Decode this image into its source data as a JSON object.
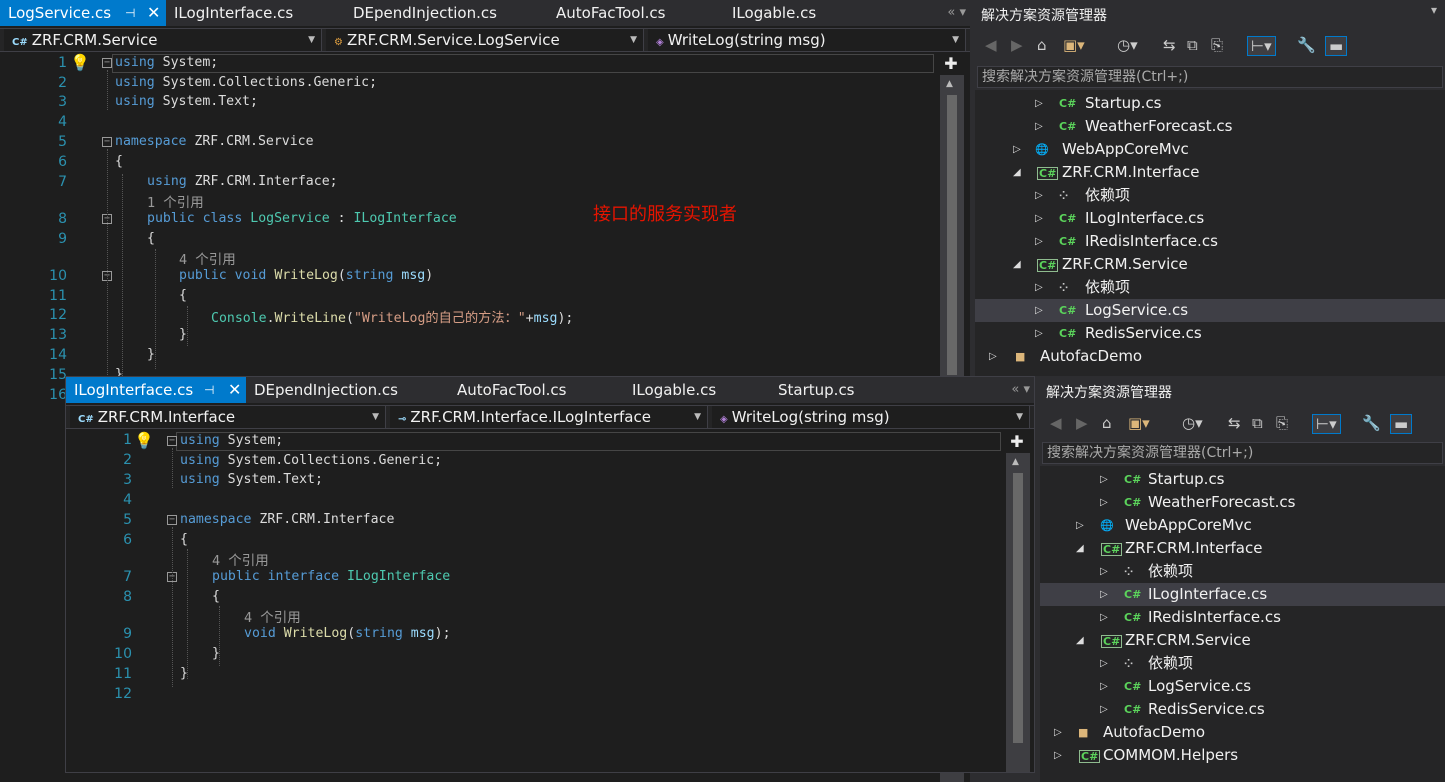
{
  "window1": {
    "tabs": [
      {
        "label": "LogService.cs",
        "active": true
      },
      {
        "label": "ILogInterface.cs"
      },
      {
        "label": "DEpendInjection.cs"
      },
      {
        "label": "AutoFacTool.cs"
      },
      {
        "label": "ILogable.cs"
      }
    ],
    "nav": {
      "project": "ZRF.CRM.Service",
      "type": "ZRF.CRM.Service.LogService",
      "member": "WriteLog(string msg)"
    },
    "line_numbers": [
      "1",
      "2",
      "3",
      "4",
      "5",
      "6",
      "7",
      "8",
      "9",
      "10",
      "11",
      "12",
      "13",
      "14",
      "15",
      "16"
    ],
    "ref_8": "1 个引用",
    "ref_10": "4 个引用",
    "annotation": "接口的服务实现者"
  },
  "window2": {
    "tabs": [
      {
        "label": "ILogInterface.cs",
        "active": true
      },
      {
        "label": "DEpendInjection.cs"
      },
      {
        "label": "AutoFacTool.cs"
      },
      {
        "label": "ILogable.cs"
      },
      {
        "label": "Startup.cs"
      }
    ],
    "nav": {
      "project": "ZRF.CRM.Interface",
      "type": "ZRF.CRM.Interface.ILogInterface",
      "member": "WriteLog(string msg)"
    },
    "line_numbers": [
      "1",
      "2",
      "3",
      "4",
      "5",
      "6",
      "7",
      "8",
      "9",
      "10",
      "11",
      "12"
    ],
    "ref_7": "4 个引用",
    "ref_9": "4 个引用"
  },
  "code": {
    "using": "using",
    "system": "System;",
    "sys_collections": "System.Collections.Generic;",
    "sys_text": "System.Text;",
    "namespace": "namespace",
    "ns_service": "ZRF.CRM.Service",
    "ns_interface": "ZRF.CRM.Interface",
    "ns_interface_semi": "ZRF.CRM.Interface;",
    "open": "{",
    "close": "}",
    "public": "public",
    "class": "class",
    "LogService": "LogService",
    "colon": " : ",
    "ILogInterface": "ILogInterface",
    "void": "void",
    "WriteLog": "WriteLog",
    "string": "string",
    "msg": "msg",
    "paren_open": "(",
    "paren_close": ")",
    "paren_close_semi": ");",
    "Console": "Console",
    "WriteLine": "WriteLine",
    "str": "\"WriteLog的自己的方法：\"",
    "plus": "+",
    "interface": "interface"
  },
  "solution_explorer": {
    "title": "解决方案资源管理器",
    "search": "搜索解决方案资源管理器(Ctrl+;)",
    "items1": [
      "Startup.cs",
      "WeatherForecast.cs",
      "WebAppCoreMvc",
      "ZRF.CRM.Interface",
      "依赖项",
      "ILogInterface.cs",
      "IRedisInterface.cs",
      "ZRF.CRM.Service",
      "依赖项",
      "LogService.cs",
      "RedisService.cs",
      "AutofacDemo"
    ],
    "items2": [
      "Startup.cs",
      "WeatherForecast.cs",
      "WebAppCoreMvc",
      "ZRF.CRM.Interface",
      "依赖项",
      "ILogInterface.cs",
      "IRedisInterface.cs",
      "ZRF.CRM.Service",
      "依赖项",
      "LogService.cs",
      "RedisService.cs",
      "AutofacDemo",
      "COMMOM.Helpers"
    ]
  },
  "colors": {
    "accent": "#007acc",
    "annotation": "#e51400",
    "keyword": "#569cd6",
    "type": "#4ec9b0",
    "string": "#d69d85"
  }
}
